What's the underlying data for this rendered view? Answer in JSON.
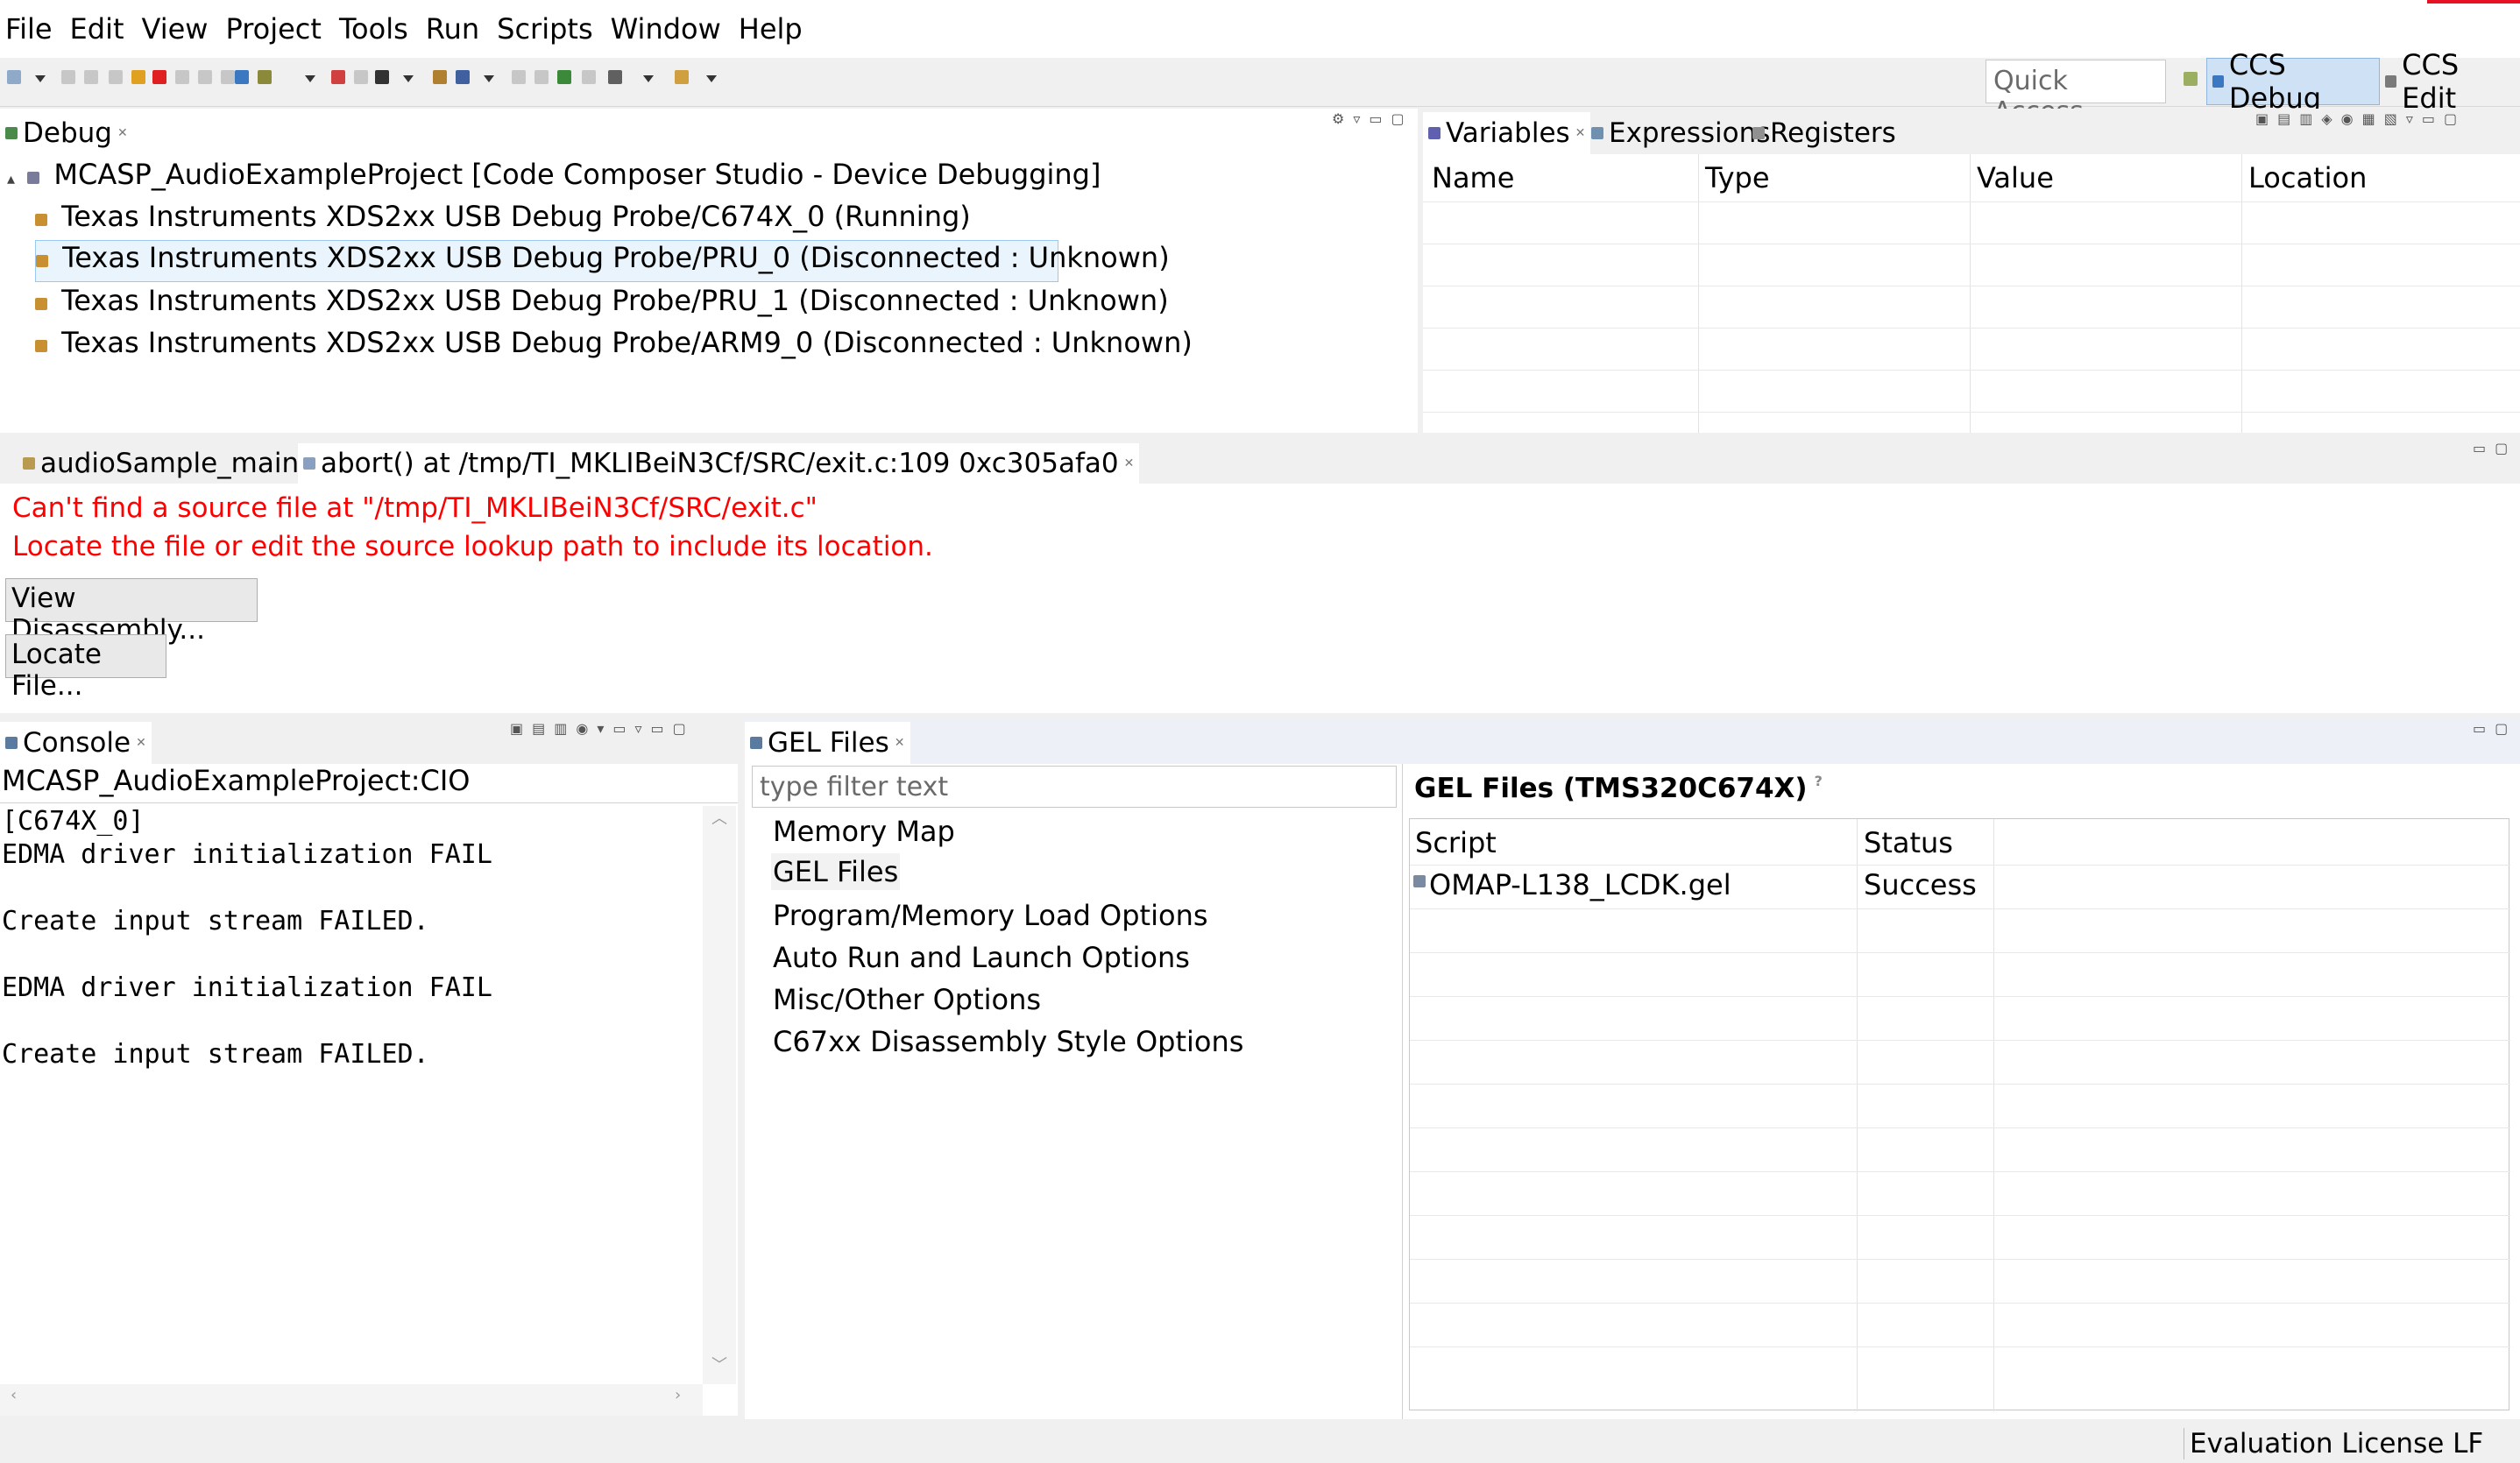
{
  "menu": [
    "File",
    "Edit",
    "View",
    "Project",
    "Tools",
    "Run",
    "Scripts",
    "Window",
    "Help"
  ],
  "toolbar": {
    "quick_access_placeholder": "Quick Access",
    "perspectives": [
      {
        "label": "CCS Debug",
        "active": true
      },
      {
        "label": "CCS Edit",
        "active": false
      }
    ]
  },
  "debug_view": {
    "tab": "Debug",
    "project": "MCASP_AudioExampleProject [Code Composer Studio - Device Debugging]",
    "items": [
      "Texas Instruments XDS2xx USB Debug Probe/C674X_0 (Running)",
      "Texas Instruments XDS2xx USB Debug Probe/PRU_0 (Disconnected : Unknown)",
      "Texas Instruments XDS2xx USB Debug Probe/PRU_1 (Disconnected : Unknown)",
      "Texas Instruments XDS2xx USB Debug Probe/ARM9_0 (Disconnected : Unknown)"
    ]
  },
  "variables_view": {
    "tabs": [
      "Variables",
      "Expressions",
      "Registers"
    ],
    "columns": [
      "Name",
      "Type",
      "Value",
      "Location"
    ]
  },
  "editor": {
    "tabs": [
      "audioSample_main.c",
      "abort() at /tmp/TI_MKLIBeiN3Cf/SRC/exit.c:109 0xc305afa0"
    ],
    "error_line1": "Can't find a source file at \"/tmp/TI_MKLIBeiN3Cf/SRC/exit.c\"",
    "error_line2": "Locate the file or edit the source lookup path to include its location.",
    "btn_disassembly": "View Disassembly...",
    "btn_locate": "Locate File..."
  },
  "console": {
    "tab": "Console",
    "title": "MCASP_AudioExampleProject:CIO",
    "lines": [
      "[C674X_0]",
      "EDMA driver initialization FAIL",
      "",
      "Create input stream FAILED.",
      "",
      "EDMA driver initialization FAIL",
      "",
      "Create input stream FAILED."
    ]
  },
  "gel": {
    "tab": "GEL Files",
    "filter_placeholder": "type filter text",
    "nav": [
      "Memory Map",
      "GEL Files",
      "Program/Memory Load Options",
      "Auto Run and Launch Options",
      "Misc/Other Options",
      "C67xx Disassembly Style Options"
    ],
    "heading": "GEL Files (TMS320C674X)",
    "columns": [
      "Script",
      "Status"
    ],
    "rows": [
      {
        "script": "OMAP-L138_LCDK.gel",
        "status": "Success"
      }
    ]
  },
  "status_bar": "Evaluation License LF"
}
